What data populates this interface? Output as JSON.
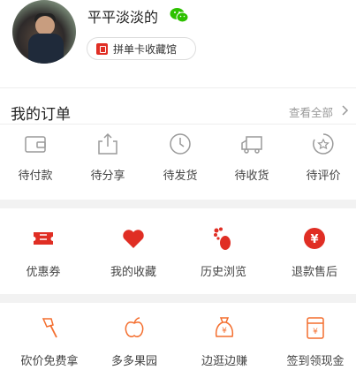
{
  "profile": {
    "username": "平平淡淡的",
    "card_hall_label": "拼单卡收藏馆"
  },
  "orders": {
    "title": "我的订单",
    "view_all": "查看全部",
    "items": [
      {
        "label": "待付款",
        "icon": "wallet-icon"
      },
      {
        "label": "待分享",
        "icon": "share-icon"
      },
      {
        "label": "待发货",
        "icon": "clock-icon"
      },
      {
        "label": "待收货",
        "icon": "truck-icon"
      },
      {
        "label": "待评价",
        "icon": "star-rating-icon"
      }
    ]
  },
  "services": {
    "items": [
      {
        "label": "优惠券",
        "icon": "coupon-icon"
      },
      {
        "label": "我的收藏",
        "icon": "heart-icon"
      },
      {
        "label": "历史浏览",
        "icon": "footprint-icon"
      },
      {
        "label": "退款售后",
        "icon": "refund-yen-icon"
      }
    ]
  },
  "activities": {
    "items": [
      {
        "label": "砍价免费拿",
        "icon": "axe-icon"
      },
      {
        "label": "多多果园",
        "icon": "fruit-icon"
      },
      {
        "label": "边逛边赚",
        "icon": "money-bag-icon"
      },
      {
        "label": "签到领现金",
        "icon": "cash-envelope-icon"
      }
    ]
  },
  "colors": {
    "accent_red": "#e02e24",
    "accent_orange": "#f46e2e",
    "wechat_green": "#2dc100",
    "icon_gray": "#9a9a9a"
  }
}
